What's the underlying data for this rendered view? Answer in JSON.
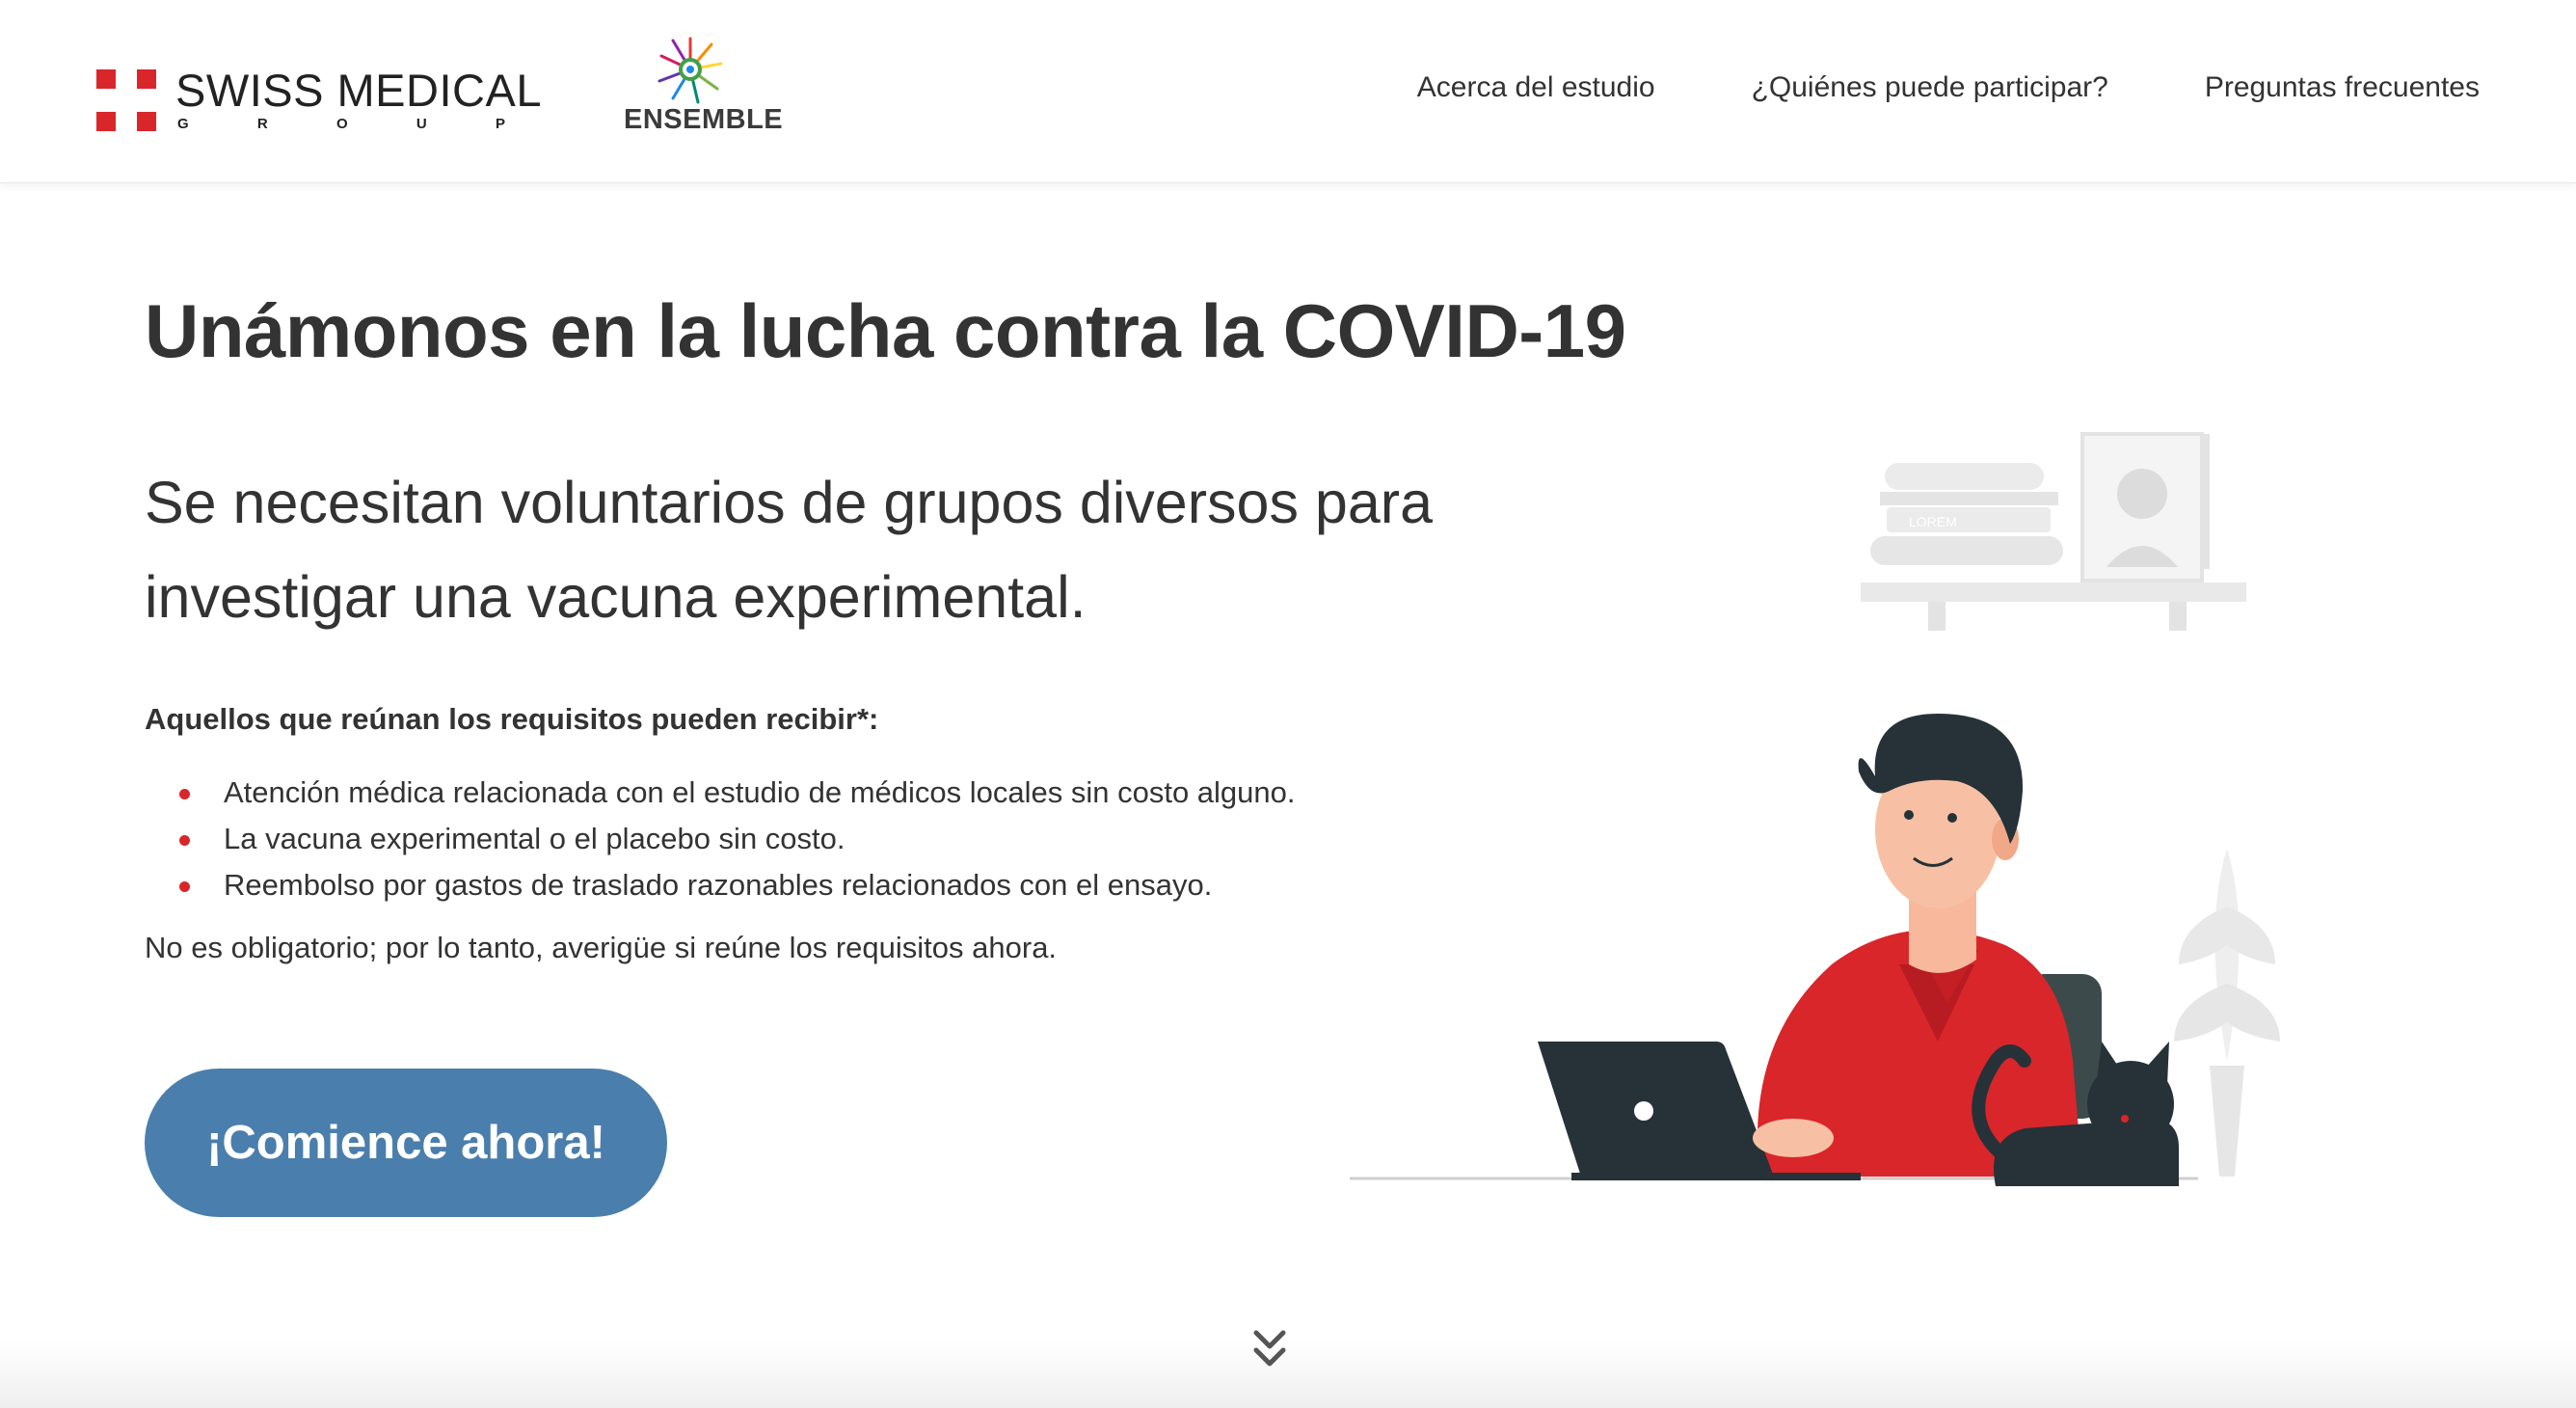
{
  "header": {
    "logo_swiss": {
      "wordmark": "SWISS MEDICAL",
      "subline": [
        "G",
        "R",
        "O",
        "U",
        "P"
      ],
      "brand_color": "#d9262a"
    },
    "logo_ensemble": {
      "label": "ENSEMBLE"
    },
    "nav": [
      {
        "label": "Acerca del estudio"
      },
      {
        "label": "¿Quiénes puede participar?"
      },
      {
        "label": "Preguntas frecuentes"
      }
    ]
  },
  "hero": {
    "title": "Unámonos en la lucha contra la COVID-19",
    "subtitle": "Se necesitan voluntarios de grupos diversos para investigar una vacuna experimental.",
    "requirements_heading": "Aquellos que reúnan los requisitos pueden recibir*:",
    "benefits": [
      "Atención médica relacionada con el estudio de médicos locales sin costo alguno.",
      "La vacuna experimental o el placebo sin costo.",
      "Reembolso por gastos de traslado razonables relacionados con el ensayo."
    ],
    "note": "No es obligatorio; por lo tanto, averigüe si reúne los requisitos ahora.",
    "cta_label": "¡Comience ahora!"
  },
  "illustration": {
    "book_label": "LOREM"
  },
  "colors": {
    "accent_red": "#d9262a",
    "cta_blue": "#4a7eac",
    "text_dark": "#333333"
  },
  "icons": {
    "scroll": "double-chevron-down-icon"
  }
}
